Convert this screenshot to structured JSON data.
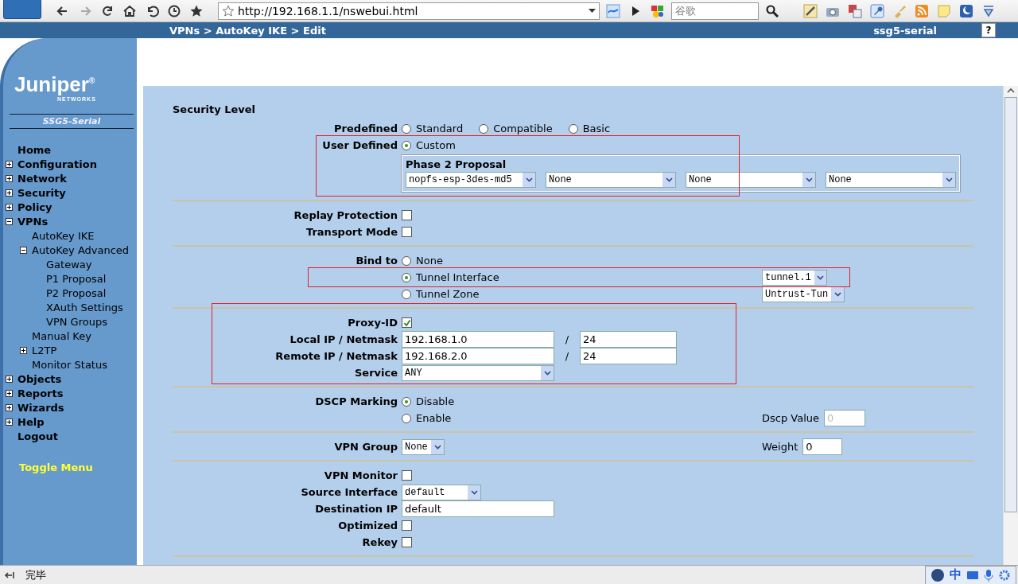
{
  "browser": {
    "address": "http://192.168.1.1/nswebui.html",
    "search_placeholder": "谷歌"
  },
  "header": {
    "breadcrumb": "VPNs > AutoKey IKE > Edit",
    "device": "ssg5-serial",
    "help": "?"
  },
  "sidebar": {
    "logo": "Juniper$^{®}$",
    "logo_sub": "NETWORKS",
    "model": "SSG5-Serial",
    "toggle": "Toggle Menu",
    "items": [
      {
        "label": "Home"
      },
      {
        "label": "Configuration",
        "expanded": false
      },
      {
        "label": "Network",
        "expanded": false
      },
      {
        "label": "Security",
        "expanded": false
      },
      {
        "label": "Policy",
        "expanded": false
      },
      {
        "label": "VPNs",
        "expanded": true,
        "children": [
          {
            "label": "AutoKey IKE"
          },
          {
            "label": "AutoKey Advanced",
            "expanded": true,
            "children": [
              {
                "label": "Gateway"
              },
              {
                "label": "P1 Proposal"
              },
              {
                "label": "P2 Proposal"
              },
              {
                "label": "XAuth Settings"
              },
              {
                "label": "VPN Groups"
              }
            ]
          },
          {
            "label": "Manual Key"
          },
          {
            "label": "L2TP",
            "expanded": false
          },
          {
            "label": "Monitor Status"
          }
        ]
      },
      {
        "label": "Objects",
        "expanded": false
      },
      {
        "label": "Reports",
        "expanded": false
      },
      {
        "label": "Wizards",
        "expanded": false
      },
      {
        "label": "Help",
        "expanded": false
      },
      {
        "label": "Logout"
      }
    ]
  },
  "form": {
    "title": "Security Level",
    "sections": [
      {
        "rows": [
          {
            "kind": "radios",
            "label": "Predefined",
            "options": [
              {
                "label": "Standard",
                "selected": false
              },
              {
                "label": "Compatible",
                "selected": false
              },
              {
                "label": "Basic",
                "selected": false
              }
            ]
          },
          {
            "kind": "radios",
            "label": "User Defined",
            "options": [
              {
                "label": "Custom",
                "selected": true
              }
            ]
          },
          {
            "kind": "proposal",
            "title": "Phase 2 Proposal",
            "selects": [
              "nopfs-esp-3des-md5",
              "None",
              "None",
              "None"
            ]
          }
        ]
      },
      {
        "rows": [
          {
            "kind": "checkbox",
            "label": "Replay Protection",
            "checked": false
          },
          {
            "kind": "checkbox",
            "label": "Transport Mode",
            "checked": false
          }
        ]
      },
      {
        "rows": [
          {
            "kind": "radio",
            "label": "Bind to",
            "option": "None",
            "selected": false
          },
          {
            "kind": "radio",
            "option": "Tunnel Interface",
            "selected": true,
            "right": {
              "kind": "select",
              "value": "tunnel.1"
            }
          },
          {
            "kind": "radio",
            "option": "Tunnel Zone",
            "selected": false,
            "right": {
              "kind": "select",
              "value": "Untrust-Tun"
            }
          }
        ]
      },
      {
        "rows": [
          {
            "kind": "checkbox",
            "label": "Proxy-ID",
            "checked": true
          },
          {
            "kind": "ipmask",
            "label": "Local IP / Netmask",
            "ip": "192.168.1.0",
            "slash": "/",
            "mask": "24"
          },
          {
            "kind": "ipmask",
            "label": "Remote IP / Netmask",
            "ip": "192.168.2.0",
            "slash": "/",
            "mask": "24"
          },
          {
            "kind": "select",
            "label": "Service",
            "value": "ANY"
          }
        ]
      },
      {
        "rows": [
          {
            "kind": "radio",
            "label": "DSCP Marking",
            "option": "Disable",
            "selected": true
          },
          {
            "kind": "radio",
            "option": "Enable",
            "selected": false,
            "right": {
              "kind": "input",
              "label": "Dscp Value",
              "value": "0",
              "disabled": true
            }
          }
        ]
      },
      {
        "rows": [
          {
            "kind": "select",
            "label": "VPN Group",
            "value": "None",
            "right": {
              "kind": "input",
              "label": "Weight",
              "value": "0",
              "disabled": false
            }
          }
        ]
      },
      {
        "rows": [
          {
            "kind": "checkbox",
            "label": "VPN Monitor",
            "checked": false
          },
          {
            "kind": "select",
            "label": "Source Interface",
            "value": "default"
          },
          {
            "kind": "input",
            "label": "Destination IP",
            "value": "default"
          },
          {
            "kind": "checkbox",
            "label": "Optimized",
            "checked": false
          },
          {
            "kind": "checkbox",
            "label": "Rekey",
            "checked": false
          }
        ]
      }
    ]
  },
  "status_bar": {
    "text": "完毕",
    "ime": "中"
  }
}
